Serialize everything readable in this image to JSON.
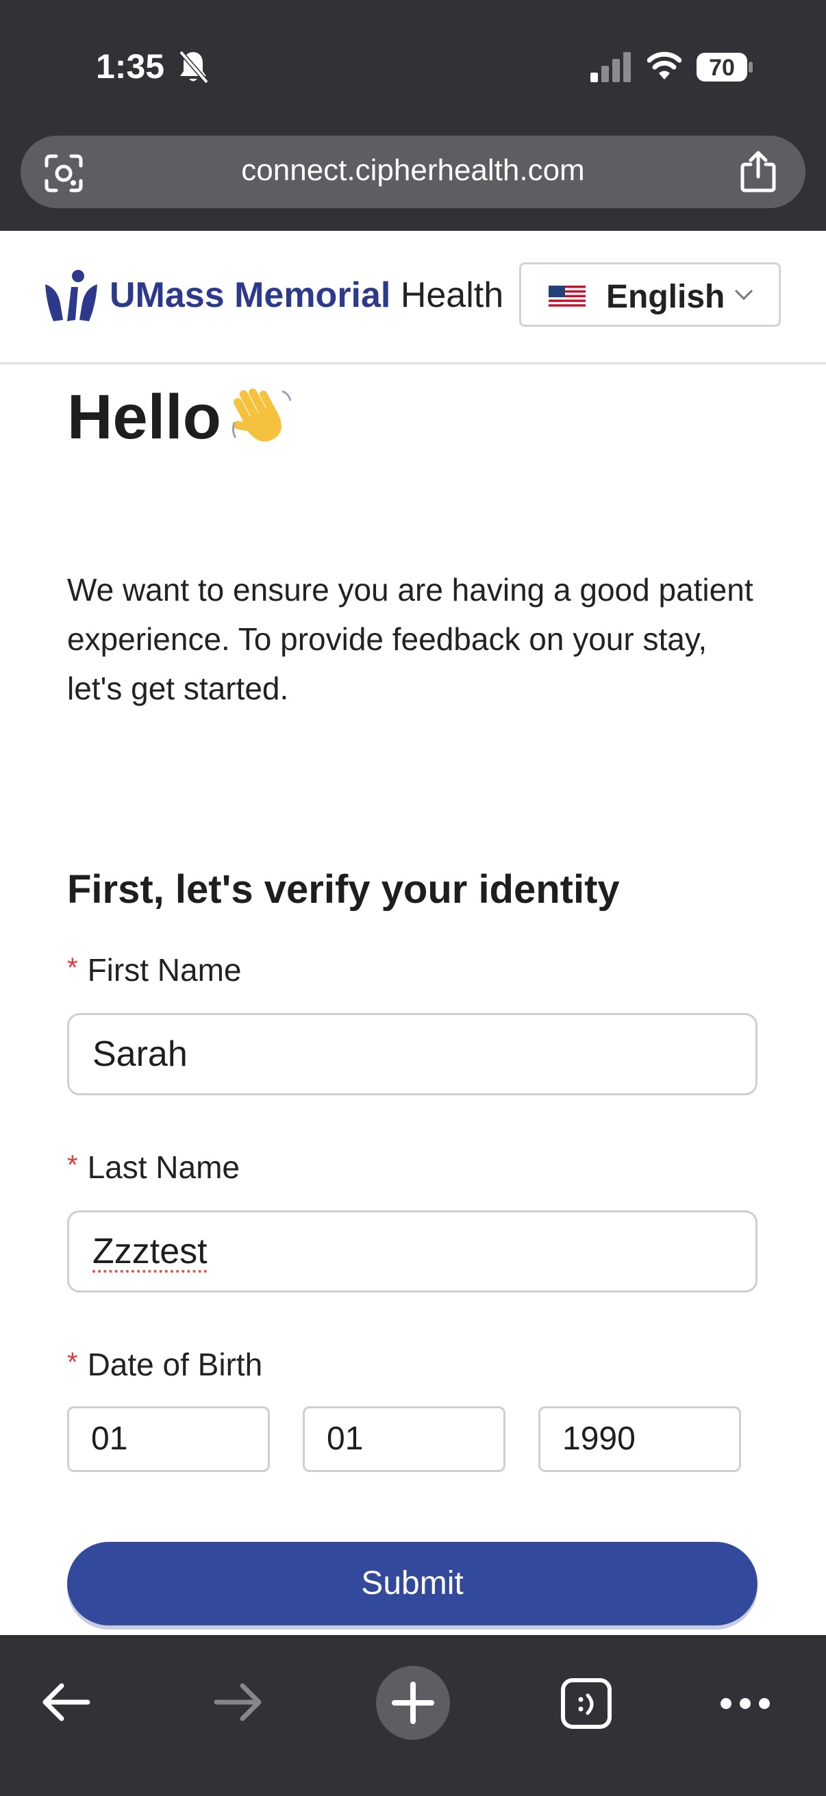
{
  "status_bar": {
    "time": "1:35",
    "battery": "70"
  },
  "browser": {
    "url": "connect.cipherhealth.com"
  },
  "header": {
    "brand_bold": "UMass Memorial",
    "brand_plain": "Health",
    "language": "English"
  },
  "content": {
    "greeting": "Hello",
    "intro": "We want to ensure you are having a good patient experience. To provide feedback on your stay, let's get started.",
    "verify_title": "First, let's verify your identity",
    "required_mark": "*",
    "first_name_label": "First Name",
    "first_name_value": "Sarah",
    "last_name_label": "Last Name",
    "last_name_value": "Zzztest",
    "dob_label": "Date of Birth",
    "dob_month": "01",
    "dob_day": "01",
    "dob_year": "1990",
    "submit_label": "Submit"
  },
  "colors": {
    "brand": "#2d3a8c",
    "submit": "#334a9c",
    "required": "#e03b3b",
    "chrome": "#303236"
  },
  "icons": [
    "bell-off-icon",
    "signal-icon",
    "wifi-icon",
    "battery-icon",
    "lens-icon",
    "share-icon",
    "flag-icon",
    "chevron-down-icon",
    "wave-icon",
    "back-arrow-icon",
    "forward-arrow-icon",
    "new-tab-icon",
    "tabs-icon",
    "more-icon"
  ]
}
